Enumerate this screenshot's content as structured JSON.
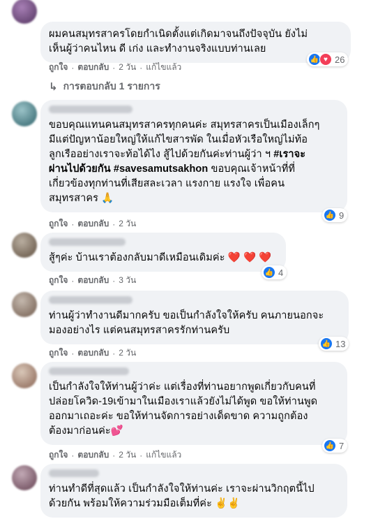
{
  "comments": [
    {
      "text": "ผมคนสมุทรสาครโดยกำเนิดตั้งแต่เกิดมาจนถึงปัจจุบัน ยังไม่\nเห็นผู้ว่าคนไหน ดี เก่ง และทำงานจริงแบบท่านเลย",
      "like_label": "ถูกใจ",
      "reply_label": "ตอบกลับ",
      "time": "2 วัน",
      "edited": "แก้ไขแล้ว",
      "reactions": [
        "like",
        "love"
      ],
      "count": "26"
    },
    {
      "text_a": "ขอบคุณแทนคนสมุทรสาครทุกคนค่ะ สมุทรสาครเป็นเมืองเล็กๆ\nมีแต่ปัญหาน้อยใหญ่ให้แก้ไขสารพัด ในเมื่อหัวเรือใหญ่ไม่ท้อ\nลูกเรืออย่างเราจะท้อได้ไง สู้ไปด้วยกันค่ะท่านผู้ว่า ฯ ",
      "hashtag_1": "#เราจะ\nผ่านไปด้วยกัน",
      "hashtag_2": " #savesamutsakhon",
      "text_b": " ขอบคุณเจ้าหน้าที่ที่\nเกี่ยวข้องทุกท่านที่เสียสละเวลา แรงกาย แรงใจ เพื่อคน\nสมุทรสาคร 🙏",
      "like_label": "ถูกใจ",
      "reply_label": "ตอบกลับ",
      "time": "2 วัน",
      "reactions": [
        "like"
      ],
      "count": "9"
    },
    {
      "text": "สู้ๆค่ะ บ้านเราต้องกลับมาดีเหมือนเดิมค่ะ",
      "hearts": "❤️ ❤️ ❤️",
      "like_label": "ถูกใจ",
      "reply_label": "ตอบกลับ",
      "time": "3 วัน",
      "reactions": [
        "like"
      ],
      "count": "4"
    },
    {
      "text": "ท่านผู้ว่าทำงานดีมากครับ ขอเป็นกำลังใจให้ครับ คนภายนอกจะ\nมองอย่างไร แต่คนสมุทรสาครรักท่านครับ",
      "like_label": "ถูกใจ",
      "reply_label": "ตอบกลับ",
      "time": "2 วัน",
      "reactions": [
        "like"
      ],
      "count": "13"
    },
    {
      "text": "เป็นกำลังใจให้ท่านผู้ว่าค่ะ แต่เรื่องที่ท่านอยากพูดเกี่ยวกับคนที่\nปล่อยโควิด-19เข้ามาในเมืองเราแล้วยังไม่ได้พูด ขอให้ท่านพูด\nออกมาเถอะค่ะ ขอให้ท่านจัดการอย่างเด็ดขาด ความถูกต้อง\nต้องมาก่อนค่ะ💕",
      "like_label": "ถูกใจ",
      "reply_label": "ตอบกลับ",
      "time": "2 วัน",
      "edited": "แก้ไขแล้ว",
      "reactions": [
        "like"
      ],
      "count": "7"
    },
    {
      "text": "ท่านทำดีที่สุดแล้ว เป็นกำลังใจให้ท่านค่ะ เราจะผ่านวิกฤตนี้ไป\nด้วยกัน พร้อมให้ความร่วมมือเต็มที่ค่ะ ✌️✌️"
    }
  ],
  "replies_label": "การตอบกลับ 1 รายการ"
}
